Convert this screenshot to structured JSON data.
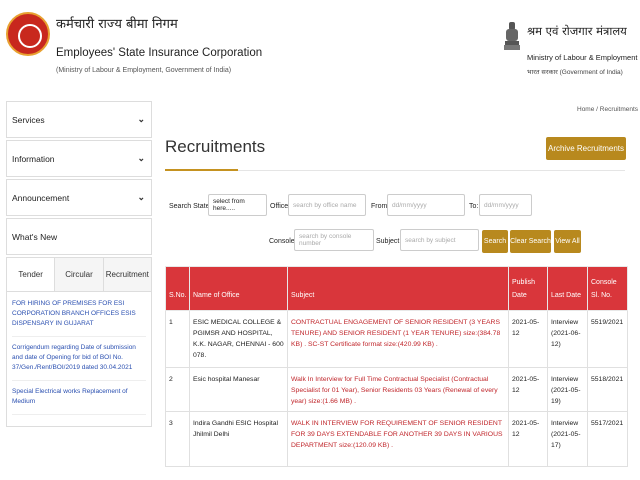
{
  "header": {
    "org_hindi": "कर्मचारी राज्य बीमा निगम",
    "org_english": "Employees' State Insurance Corporation",
    "org_sub": "(Ministry of Labour & Employment, Government of India)",
    "ministry_hindi": "श्रम एवं रोजगार मंत्रालय",
    "ministry_english": "Ministry of Labour & Employment",
    "ministry_sub": "भारत सरकार (Government of India)"
  },
  "sidebar": {
    "items": [
      {
        "label": "Services"
      },
      {
        "label": "Information"
      },
      {
        "label": "Announcement"
      },
      {
        "label": "What's New"
      }
    ],
    "tabs": [
      "Tender",
      "Circular",
      "Recruitment"
    ],
    "news": [
      "FOR HIRING OF PREMISES FOR ESI CORPORATION BRANCH OFFICES ESIS DISPENSARY IN GUJARAT",
      "Corrigendum regarding Date of submission and date of Opening for bid of BOI No. 37/Gen./Rent/BOI/2019 dated 30.04.2021",
      "Special Electrical works Replacement of Medium"
    ]
  },
  "breadcrumb": "Home / Recruitments",
  "page_title": "Recruitments",
  "archive_label": "Archive Recruitments",
  "filters": {
    "search_states_label": "Search States:",
    "state_value": "select from here.....",
    "office_label": "Office:",
    "office_placeholder": "search by office name",
    "from_label": "From:",
    "from_placeholder": "dd/mm/yyyy",
    "to_label": "To:",
    "to_placeholder": "dd/mm/yyyy",
    "console_label": "Console:",
    "console_placeholder": "search by console number",
    "subject_label": "Subject:",
    "subject_placeholder": "search by subject",
    "search_btn": "Search",
    "clear_btn": "Clear Search",
    "viewall_btn": "View All"
  },
  "table": {
    "headers": [
      "S.No.",
      "Name of Office",
      "Subject",
      "Publish Date",
      "Last Date",
      "Console Sl. No."
    ],
    "rows": [
      {
        "sno": "1",
        "office": "ESIC MEDICAL COLLEGE & PGIMSR AND HOSPITAL, K.K. NAGAR, CHENNAI - 600 078.",
        "subject": "CONTRACTUAL ENGAGEMENT OF SENIOR RESIDENT (3 YEARS TENURE) AND SENIOR RESIDENT (1 YEAR TENURE) size:(384.78 KB) . SC-ST Certificate format size:(420.99 KB) .",
        "publish": "2021-05-12",
        "last": "Interview (2021-06-12)",
        "console": "5519/2021"
      },
      {
        "sno": "2",
        "office": "Esic hospital Manesar",
        "subject": "Walk In Interview for Full Time Contractual Specialist (Contractual Specialist for 01 Year), Senior Residents 03 Years (Renewal of every year) size:(1.66 MB) .",
        "publish": "2021-05-12",
        "last": "Interview (2021-05-19)",
        "console": "5518/2021"
      },
      {
        "sno": "3",
        "office": "Indira Gandhi ESIC Hospital Jhilmil Delhi",
        "subject": "WALK IN INTERVIEW FOR REQUIREMENT OF SENIOR RESIDENT FOR 39 DAYS EXTENDABLE FOR ANOTHER 39 DAYS IN VARIOUS DEPARTMENT size:(120.09 KB) .",
        "publish": "2021-05-12",
        "last": "Interview (2021-05-17)",
        "console": "5517/2021"
      }
    ]
  },
  "colors": {
    "accent_gold": "#b8891e",
    "table_header_red": "#d9363b",
    "link_blue": "#2a4fb0"
  }
}
